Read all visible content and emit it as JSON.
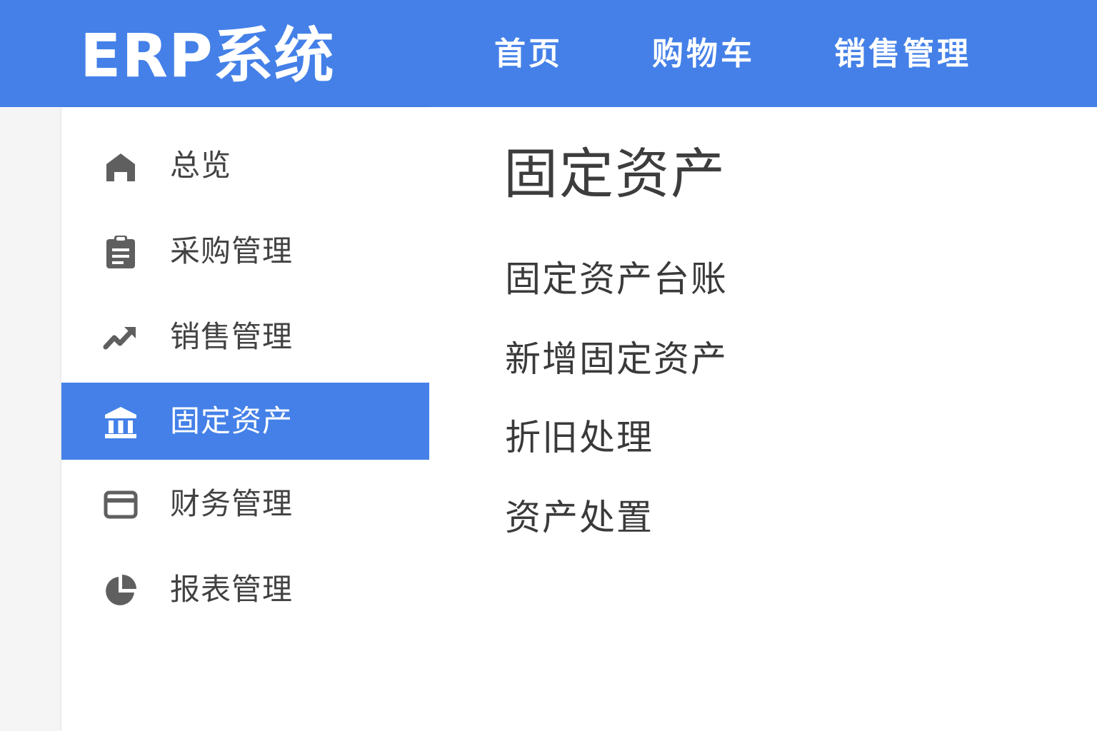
{
  "header": {
    "brand": "ERP系统",
    "nav": [
      {
        "label": "首页"
      },
      {
        "label": "购物车"
      },
      {
        "label": "销售管理"
      }
    ]
  },
  "sidebar": {
    "items": [
      {
        "label": "总览",
        "icon": "home-icon",
        "active": false
      },
      {
        "label": "采购管理",
        "icon": "clipboard-icon",
        "active": false
      },
      {
        "label": "销售管理",
        "icon": "trending-up-icon",
        "active": false
      },
      {
        "label": "固定资产",
        "icon": "bank-icon",
        "active": true
      },
      {
        "label": "财务管理",
        "icon": "credit-card-icon",
        "active": false
      },
      {
        "label": "报表管理",
        "icon": "pie-chart-icon",
        "active": false
      }
    ]
  },
  "main": {
    "title": "固定资产",
    "links": [
      {
        "label": "固定资产台账"
      },
      {
        "label": "新增固定资产"
      },
      {
        "label": "折旧处理"
      },
      {
        "label": "资产处置"
      }
    ]
  },
  "colors": {
    "accent": "#4480e8",
    "icon": "#5f5f5f",
    "text": "#424242",
    "background": "#f5f5f5"
  }
}
